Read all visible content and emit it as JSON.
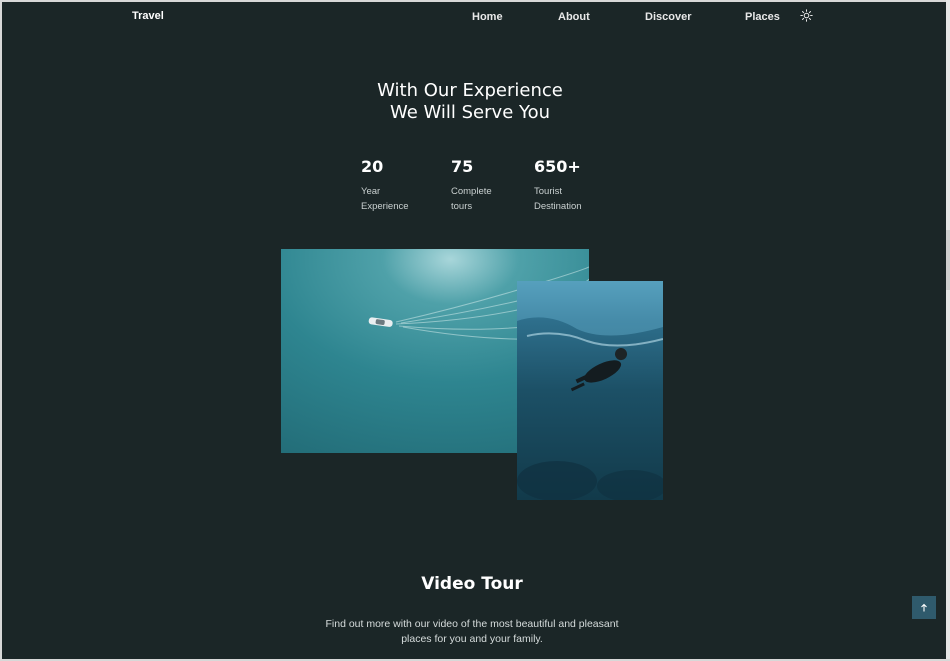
{
  "header": {
    "logo": "Travel",
    "nav": {
      "home": "Home",
      "about": "About",
      "discover": "Discover",
      "places": "Places"
    },
    "theme_icon": "sun-icon"
  },
  "hero": {
    "title_line1": "With Our Experience",
    "title_line2": "We Will Serve You"
  },
  "stats": [
    {
      "value": "20",
      "label_line1": "Year",
      "label_line2": "Experience"
    },
    {
      "value": "75",
      "label_line1": "Complete",
      "label_line2": "tours"
    },
    {
      "value": "650+",
      "label_line1": "Tourist",
      "label_line2": "Destination"
    }
  ],
  "gallery": {
    "image1": "boat-aerial-photo",
    "image2": "diver-underwater-photo"
  },
  "video_tour": {
    "title": "Video Tour",
    "description": "Find out more with our video of the most beautiful and pleasant places for you and your family."
  },
  "scroll_up_icon": "arrow-up-icon",
  "colors": {
    "background": "#1b2627",
    "accent": "#2f5a6c",
    "text": "#ffffff"
  }
}
